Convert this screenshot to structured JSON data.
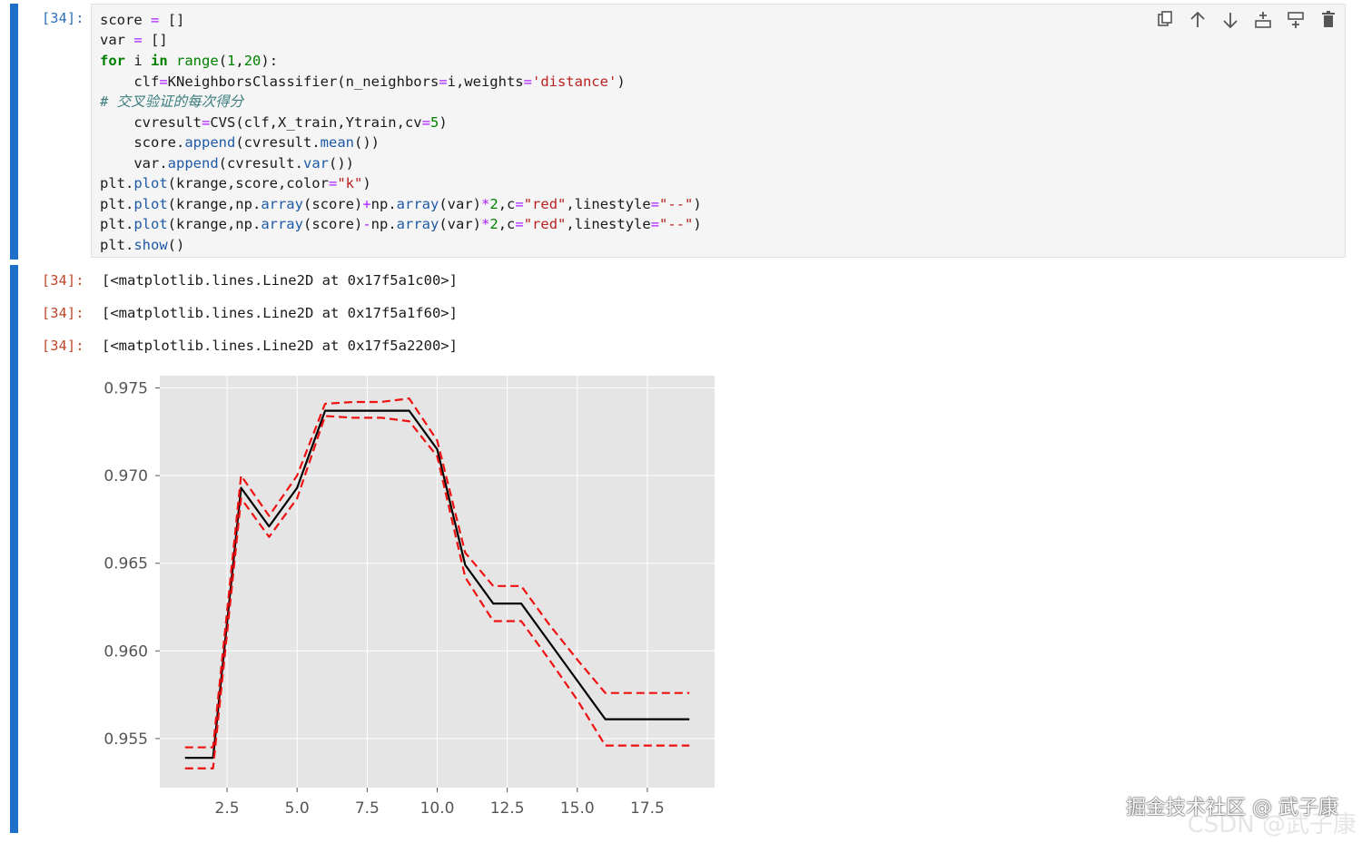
{
  "input_cell": {
    "prompt": "[34]:",
    "code_lines": [
      "score = []",
      "var = []",
      "for i in range(1,20):",
      "    clf=KNeighborsClassifier(n_neighbors=i,weights='distance')",
      "# 交叉验证的每次得分",
      "    cvresult=CVS(clf,X_train,Ytrain,cv=5)",
      "    score.append(cvresult.mean())",
      "    var.append(cvresult.var())",
      "plt.plot(krange,score,color=\"k\")",
      "plt.plot(krange,np.array(score)+np.array(var)*2,c=\"red\",linestyle=\"--\")",
      "plt.plot(krange,np.array(score)-np.array(var)*2,c=\"red\",linestyle=\"--\")",
      "plt.show()"
    ]
  },
  "toolbar": {
    "icons": [
      "copy-icon",
      "move-up-icon",
      "move-down-icon",
      "insert-above-icon",
      "insert-below-icon",
      "delete-icon"
    ]
  },
  "output_cell": {
    "prompts": [
      "[34]:",
      "[34]:",
      "[34]:"
    ],
    "lines": [
      "[<matplotlib.lines.Line2D at 0x17f5a1c00>]",
      "[<matplotlib.lines.Line2D at 0x17f5a1f60>]",
      "[<matplotlib.lines.Line2D at 0x17f5a2200>]"
    ]
  },
  "chart_data": {
    "type": "line",
    "title": "",
    "xlabel": "",
    "ylabel": "",
    "xlim": [
      0.1,
      19.9
    ],
    "ylim": [
      0.9522,
      0.9757
    ],
    "x_ticks": [
      2.5,
      5.0,
      7.5,
      10.0,
      12.5,
      15.0,
      17.5
    ],
    "x_tick_labels": [
      "2.5",
      "5.0",
      "7.5",
      "10.0",
      "12.5",
      "15.0",
      "17.5"
    ],
    "y_ticks": [
      0.955,
      0.96,
      0.965,
      0.97,
      0.975
    ],
    "y_tick_labels": [
      "0.955",
      "0.960",
      "0.965",
      "0.970",
      "0.975"
    ],
    "grid": true,
    "x": [
      1,
      2,
      3,
      4,
      5,
      6,
      7,
      8,
      9,
      10,
      11,
      12,
      13,
      14,
      15,
      16,
      17,
      18,
      19
    ],
    "series": [
      {
        "color": "#000000",
        "linestyle": "solid",
        "values": [
          0.9539,
          0.9539,
          0.9693,
          0.9671,
          0.9693,
          0.9737,
          0.9737,
          0.9737,
          0.9737,
          0.9715,
          0.9649,
          0.9627,
          0.9627,
          0.9605,
          0.9583,
          0.9561,
          0.9561,
          0.9561,
          0.9561
        ]
      },
      {
        "color": "#ee1111",
        "linestyle": "dashed",
        "values": [
          0.9545,
          0.9545,
          0.97,
          0.9677,
          0.97,
          0.9741,
          0.9742,
          0.9742,
          0.9744,
          0.972,
          0.9656,
          0.9637,
          0.9637,
          0.9615,
          0.9595,
          0.9576,
          0.9576,
          0.9576,
          0.9576
        ]
      },
      {
        "color": "#ee1111",
        "linestyle": "dashed",
        "values": [
          0.9533,
          0.9533,
          0.9687,
          0.9665,
          0.9687,
          0.9734,
          0.9733,
          0.9733,
          0.9731,
          0.9711,
          0.9642,
          0.9617,
          0.9617,
          0.9595,
          0.9572,
          0.9546,
          0.9546,
          0.9546,
          0.9546
        ]
      }
    ]
  },
  "watermark": {
    "primary": "掘金技术社区 @ 武子康",
    "secondary": "CSDN @武子康"
  }
}
